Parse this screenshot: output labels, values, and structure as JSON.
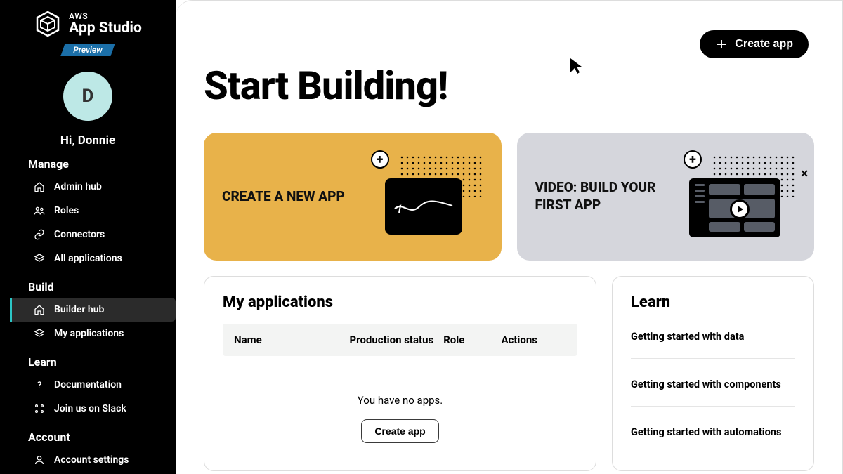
{
  "brand": {
    "top": "AWS",
    "bottom": "App Studio",
    "badge": "Preview"
  },
  "user": {
    "initial": "D",
    "greeting": "Hi, Donnie"
  },
  "sidebar": {
    "sections": {
      "manage": {
        "label": "Manage",
        "items": [
          {
            "label": "Admin hub"
          },
          {
            "label": "Roles"
          },
          {
            "label": "Connectors"
          },
          {
            "label": "All applications"
          }
        ]
      },
      "build": {
        "label": "Build",
        "items": [
          {
            "label": "Builder hub"
          },
          {
            "label": "My applications"
          }
        ]
      },
      "learn": {
        "label": "Learn",
        "items": [
          {
            "label": "Documentation"
          },
          {
            "label": "Join us on Slack"
          }
        ]
      },
      "account": {
        "label": "Account",
        "items": [
          {
            "label": "Account settings"
          }
        ]
      }
    }
  },
  "header": {
    "create_app": "Create app"
  },
  "page": {
    "title": "Start Building!"
  },
  "cards": {
    "create": "CREATE A NEW APP",
    "video": "VIDEO: BUILD YOUR FIRST APP"
  },
  "my_apps": {
    "title": "My applications",
    "columns": {
      "name": "Name",
      "status": "Production status",
      "role": "Role",
      "actions": "Actions"
    },
    "empty": "You have no apps.",
    "create_btn": "Create app"
  },
  "learn_panel": {
    "title": "Learn",
    "items": [
      "Getting started with data",
      "Getting started with components",
      "Getting started with automations"
    ]
  }
}
